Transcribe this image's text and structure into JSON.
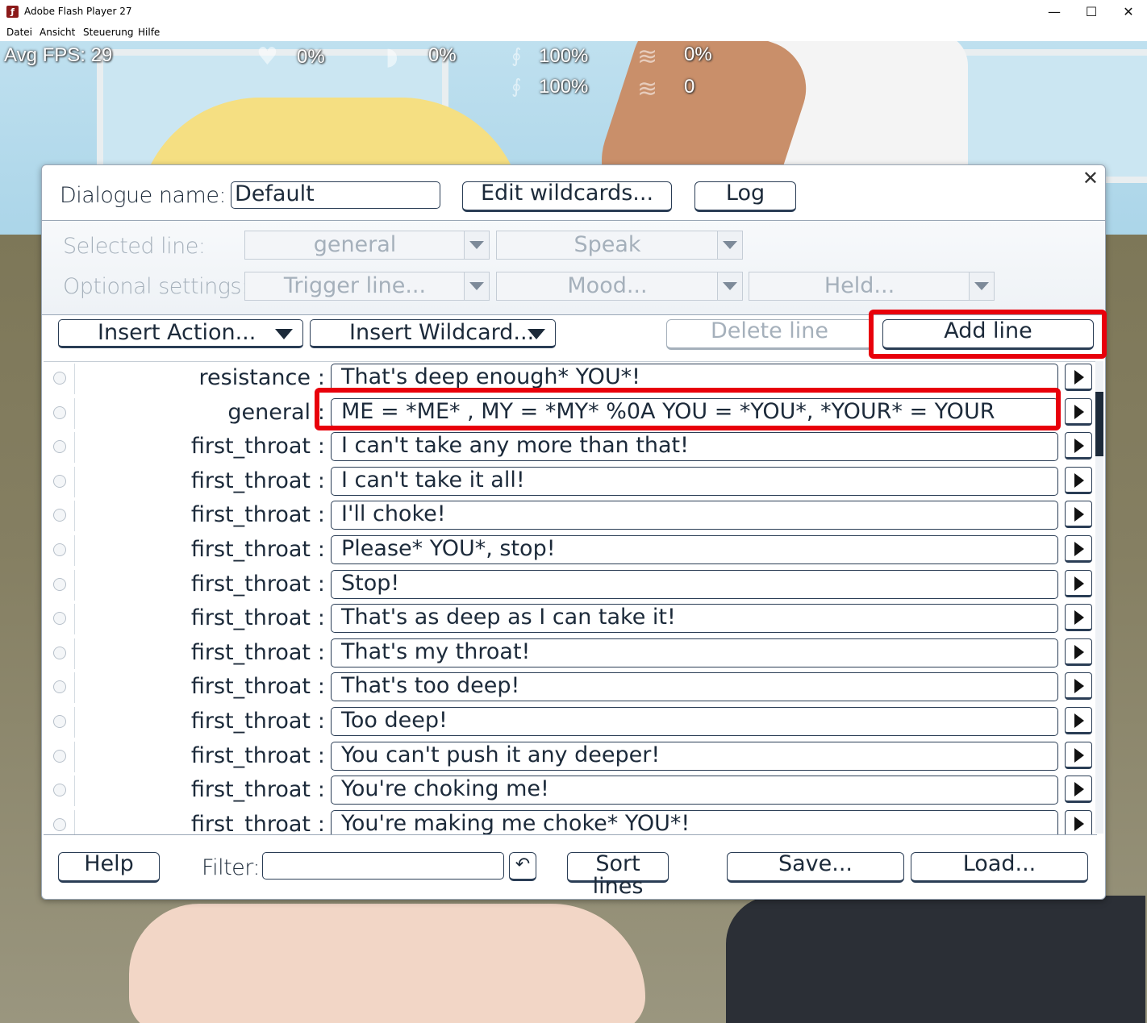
{
  "window": {
    "title": "Adobe Flash Player 27",
    "icon": "flash-logo",
    "controls": {
      "minimize": "—",
      "maximize": "☐",
      "close": "✕"
    }
  },
  "menu": [
    "Datei",
    "Ansicht",
    "Steuerung",
    "Hilfe"
  ],
  "hud": {
    "fps": "Avg FPS: 29",
    "stats": [
      {
        "icon": "heart-icon",
        "value": "0%"
      },
      {
        "icon": "breath-icon",
        "value": "0%"
      },
      {
        "icon": "sperm-icon",
        "value": "100%"
      },
      {
        "icon": "sperm-icon-2",
        "value": "100%"
      },
      {
        "icon": "splash-icon",
        "value": "0%"
      },
      {
        "icon": "splash-count-icon",
        "value": "0"
      }
    ]
  },
  "dialog": {
    "name_label": "Dialogue name:",
    "name_value": "Default",
    "edit_wildcards": "Edit wildcards...",
    "log": "Log",
    "selected_line_label": "Selected line:",
    "optional_settings_label": "Optional settings:",
    "dropdowns": {
      "category": "general",
      "type": "Speak",
      "trigger": "Trigger line...",
      "mood": "Mood...",
      "held": "Held..."
    },
    "insert_action": "Insert Action...",
    "insert_wildcard": "Insert Wildcard...",
    "delete_line": "Delete line",
    "add_line": "Add line",
    "lines": [
      {
        "category": "resistance",
        "text": "That's deep enough* YOU*!"
      },
      {
        "category": "general",
        "text": "ME = *ME* , MY = *MY* %0A YOU = *YOU*, *YOUR* = YOUR"
      },
      {
        "category": "first_throat",
        "text": "I can't take any more than that!"
      },
      {
        "category": "first_throat",
        "text": "I can't take it all!"
      },
      {
        "category": "first_throat",
        "text": "I'll choke!"
      },
      {
        "category": "first_throat",
        "text": "Please* YOU*, stop!"
      },
      {
        "category": "first_throat",
        "text": "Stop!"
      },
      {
        "category": "first_throat",
        "text": "That's as deep as I can take it!"
      },
      {
        "category": "first_throat",
        "text": "That's my throat!"
      },
      {
        "category": "first_throat",
        "text": "That's too deep!"
      },
      {
        "category": "first_throat",
        "text": "Too deep!"
      },
      {
        "category": "first_throat",
        "text": "You can't push it any deeper!"
      },
      {
        "category": "first_throat",
        "text": "You're choking me!"
      },
      {
        "category": "first_throat",
        "text": "You're making me choke* YOU*!"
      }
    ],
    "help": "Help",
    "filter_label": "Filter:",
    "filter_value": "",
    "undo_icon": "↶",
    "sort_lines": "Sort lines",
    "save": "Save...",
    "load": "Load..."
  },
  "colors": {
    "highlight": "#e8000b",
    "ink": "#1c2a3a",
    "disabled": "#a5b0bb"
  }
}
